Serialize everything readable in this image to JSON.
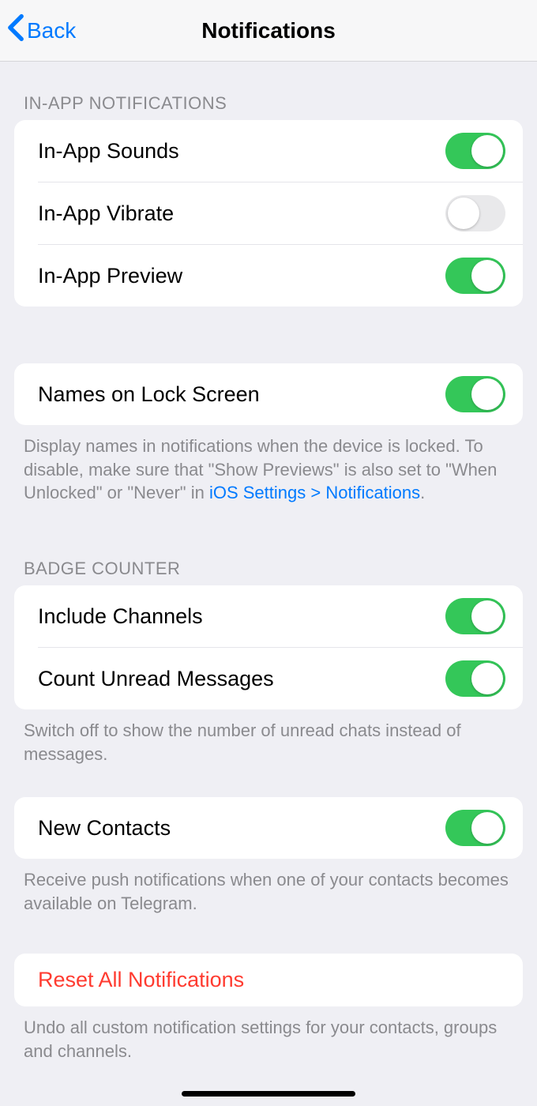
{
  "nav": {
    "back": "Back",
    "title": "Notifications"
  },
  "sections": {
    "inapp": {
      "header": "In-App Notifications",
      "sounds": {
        "label": "In-App Sounds",
        "on": true
      },
      "vibrate": {
        "label": "In-App Vibrate",
        "on": false
      },
      "preview": {
        "label": "In-App Preview",
        "on": true
      }
    },
    "lockscreen": {
      "names": {
        "label": "Names on Lock Screen",
        "on": true
      },
      "footer_a": "Display names in notifications when the device is locked. To disable, make sure that \"Show Previews\" is also set to \"When Unlocked\" or \"Never\" in ",
      "footer_link": "iOS Settings > Notifications",
      "footer_b": "."
    },
    "badge": {
      "header": "Badge Counter",
      "channels": {
        "label": "Include Channels",
        "on": true
      },
      "unread": {
        "label": "Count Unread Messages",
        "on": true
      },
      "footer": "Switch off to show the number of unread chats instead of messages."
    },
    "contacts": {
      "new": {
        "label": "New Contacts",
        "on": true
      },
      "footer": "Receive push notifications when one of your contacts becomes available on Telegram."
    },
    "reset": {
      "label": "Reset All Notifications",
      "footer": "Undo all custom notification settings for your contacts, groups and channels."
    }
  }
}
